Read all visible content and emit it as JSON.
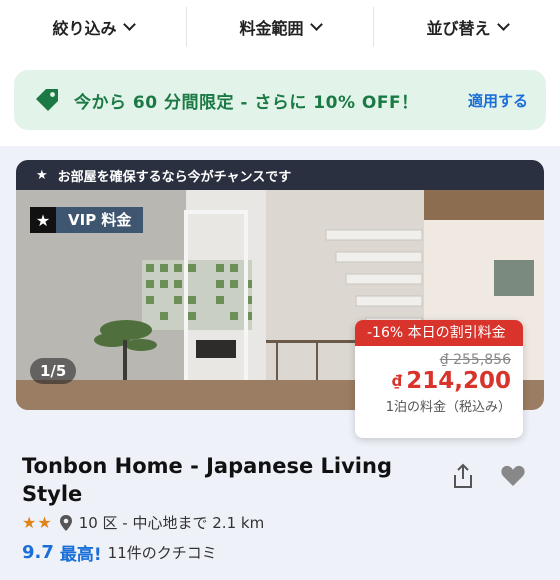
{
  "filters": {
    "narrow": "絞り込み",
    "price_range": "料金範囲",
    "sort": "並び替え"
  },
  "promo": {
    "text": "今から 60 分間限定 - さらに 10% OFF！",
    "apply": "適用する",
    "icon": "tag-icon",
    "color": "#1b7a44"
  },
  "listing": {
    "banner": "お部屋を確保するなら今がチャンスです",
    "vip_label": "VIP 料金",
    "photo_counter": "1/5",
    "price": {
      "deal": "-16% 本日の割引料金",
      "old": "₫ 255,856",
      "currency": "₫",
      "new": "214,200",
      "note": "1泊の料金（税込み）"
    },
    "name": "Tonbon Home - Japanese Living Style",
    "stars": "★★",
    "location": "10 区 - 中心地まで 2.1 km",
    "score": "9.7",
    "score_word": "最高!",
    "reviews": "11件のクチコミ"
  },
  "colors": {
    "accent_blue": "#1a6ed8",
    "deal_red": "#d8342c",
    "promo_bg": "#e2f3ea"
  }
}
